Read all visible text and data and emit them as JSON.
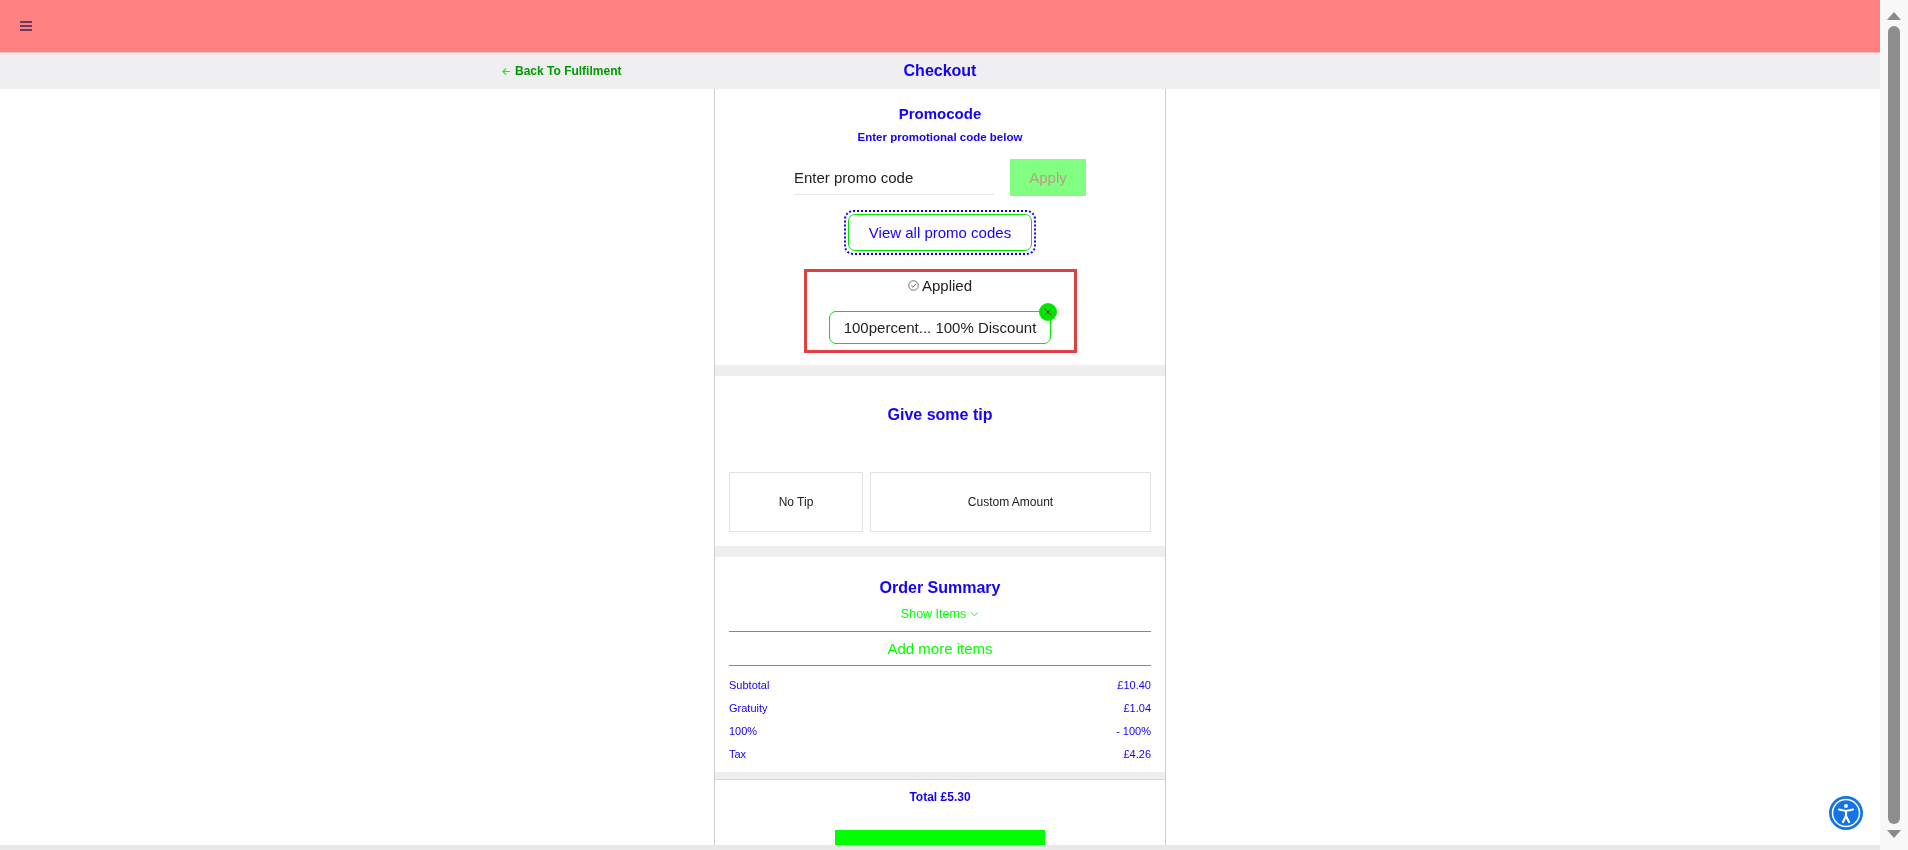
{
  "nav": {
    "back_link": "Back To Fulfilment",
    "title": "Checkout"
  },
  "promo": {
    "title": "Promocode",
    "subtitle": "Enter promotional code below",
    "input": {
      "placeholder": "Enter promo code"
    },
    "apply_button": {
      "label": "Apply",
      "disabled": true
    },
    "view_all_button": "View all promo codes",
    "applied": {
      "status": "Applied",
      "chip": "100percent... 100% Discount"
    }
  },
  "tip": {
    "title": "Give some tip",
    "options": [
      {
        "label": "No Tip",
        "selected": false
      },
      {
        "label": "Custom Amount",
        "selected": false
      }
    ]
  },
  "summary": {
    "title": "Order Summary",
    "show_items": "Show Items",
    "expanded": false,
    "add_more": "Add more items",
    "rows": [
      {
        "label": "Subtotal",
        "value": "£10.40"
      },
      {
        "label": "Gratuity",
        "value": "£1.04"
      },
      {
        "label": "100%",
        "value": "- 100%"
      },
      {
        "label": "Tax",
        "value": "£4.26"
      }
    ],
    "total": "Total £5.30"
  }
}
